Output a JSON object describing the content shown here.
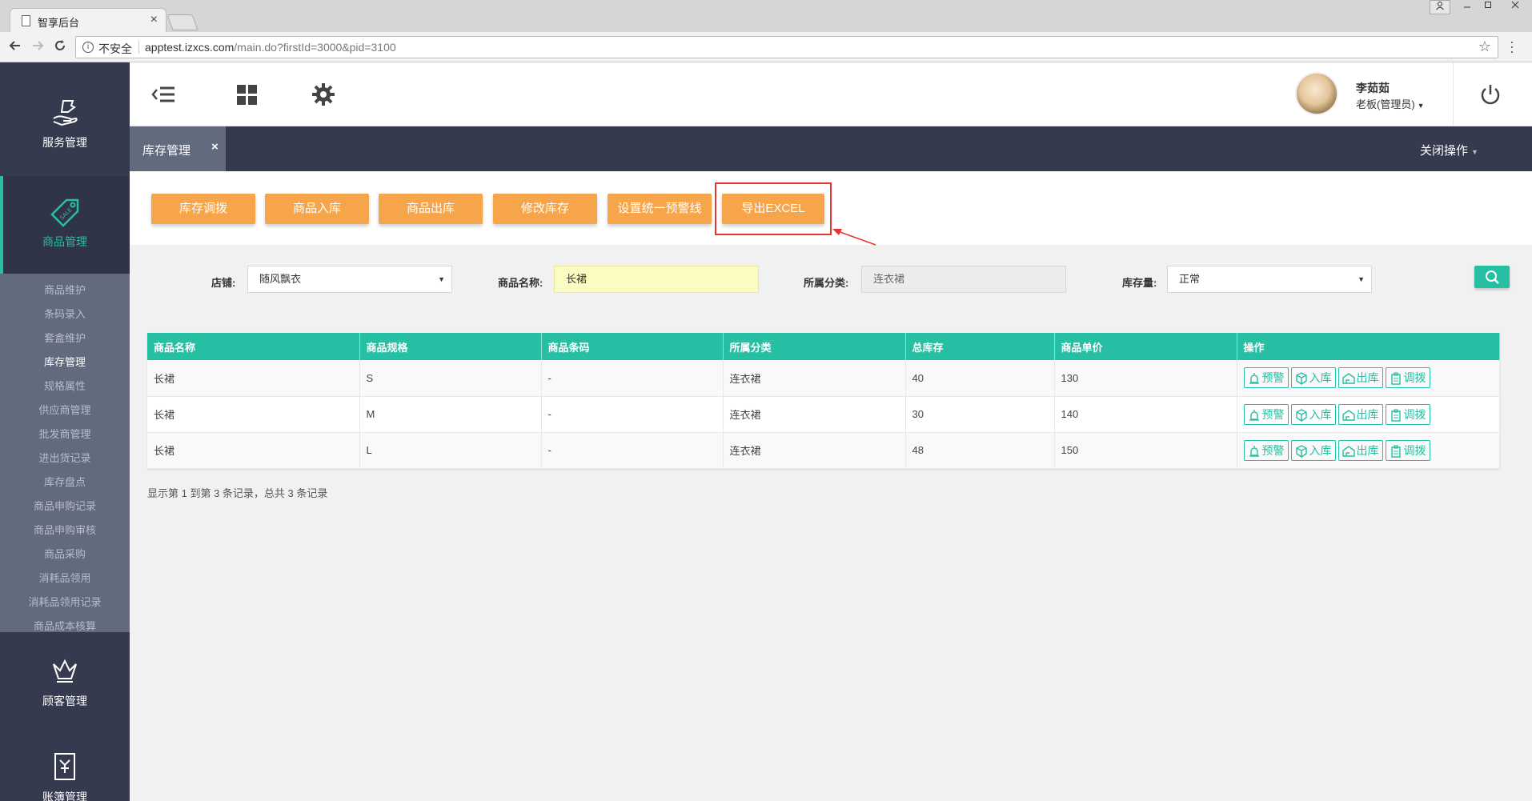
{
  "browser": {
    "tab_title": "智享后台",
    "tab_close": "×",
    "insecure_label": "不安全",
    "url_host": "apptest.izxcs.com",
    "url_path": "/main.do?firstId=3000&pid=3100"
  },
  "sidebar": {
    "service": "服务管理",
    "goods": "商品管理",
    "customer": "顾客管理",
    "account": "账簿管理",
    "submenu": [
      "商品维护",
      "条码录入",
      "套盒维护",
      "库存管理",
      "规格属性",
      "供应商管理",
      "批发商管理",
      "进出货记录",
      "库存盘点",
      "商品申购记录",
      "商品申购审核",
      "商品采购",
      "消耗品领用",
      "消耗品领用记录",
      "商品成本核算"
    ],
    "active_item": "库存管理"
  },
  "header": {
    "user_name": "李茹茹",
    "user_role": "老板(管理员)"
  },
  "tabs": {
    "current": "库存管理",
    "close": "×",
    "close_ops": "关闭操作"
  },
  "toolbar": {
    "transfer": "库存调拨",
    "stock_in": "商品入库",
    "stock_out": "商品出库",
    "modify": "修改库存",
    "set_alert": "设置统一预警线",
    "export": "导出EXCEL"
  },
  "filters": {
    "store_label": "店铺:",
    "store_value": "随风飘衣",
    "name_label": "商品名称:",
    "name_value": "长裙",
    "category_label": "所属分类:",
    "category_value": "连衣裙",
    "stock_label": "库存量:",
    "stock_value": "正常"
  },
  "table": {
    "headers": [
      "商品名称",
      "商品规格",
      "商品条码",
      "所属分类",
      "总库存",
      "商品单价",
      "操作"
    ],
    "rows": [
      [
        "长裙",
        "S",
        "-",
        "连衣裙",
        "40",
        "130"
      ],
      [
        "长裙",
        "M",
        "-",
        "连衣裙",
        "30",
        "140"
      ],
      [
        "长裙",
        "L",
        "-",
        "连衣裙",
        "48",
        "150"
      ]
    ],
    "actions": [
      "预警",
      "入库",
      "出库",
      "调拨"
    ]
  },
  "pagination": "显示第 1 到第 3 条记录，总共 3 条记录",
  "colors": {
    "accent": "#26bfa3",
    "orange": "#f7a54a",
    "sidebar": "#353a4f",
    "highlight": "#e53434"
  }
}
